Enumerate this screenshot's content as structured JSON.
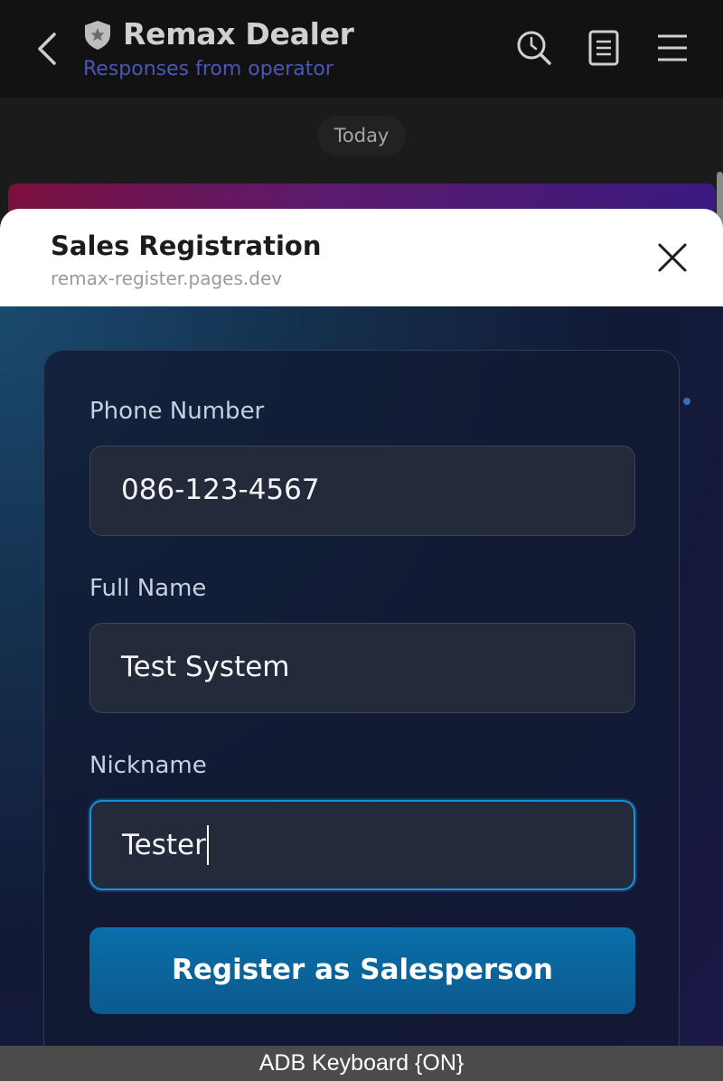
{
  "header": {
    "title": "Remax Dealer",
    "subtitle": "Responses from operator",
    "icons": [
      "back-icon",
      "shield-icon",
      "search-history-icon",
      "document-icon",
      "menu-icon"
    ],
    "colors": {
      "subtitle": "#4a56b8"
    }
  },
  "chat": {
    "date_label": "Today"
  },
  "sheet": {
    "title": "Sales Registration",
    "url": "remax-register.pages.dev"
  },
  "form": {
    "phone": {
      "label": "Phone Number",
      "value": "086-123-4567"
    },
    "full_name": {
      "label": "Full Name",
      "value": "Test System"
    },
    "nickname": {
      "label": "Nickname",
      "value": "Tester"
    },
    "submit_label": "Register as Salesperson",
    "colors": {
      "button": "#0a6fa8",
      "active_border": "#1b8fd8"
    }
  },
  "status_bar": {
    "text": "ADB Keyboard {ON}"
  }
}
